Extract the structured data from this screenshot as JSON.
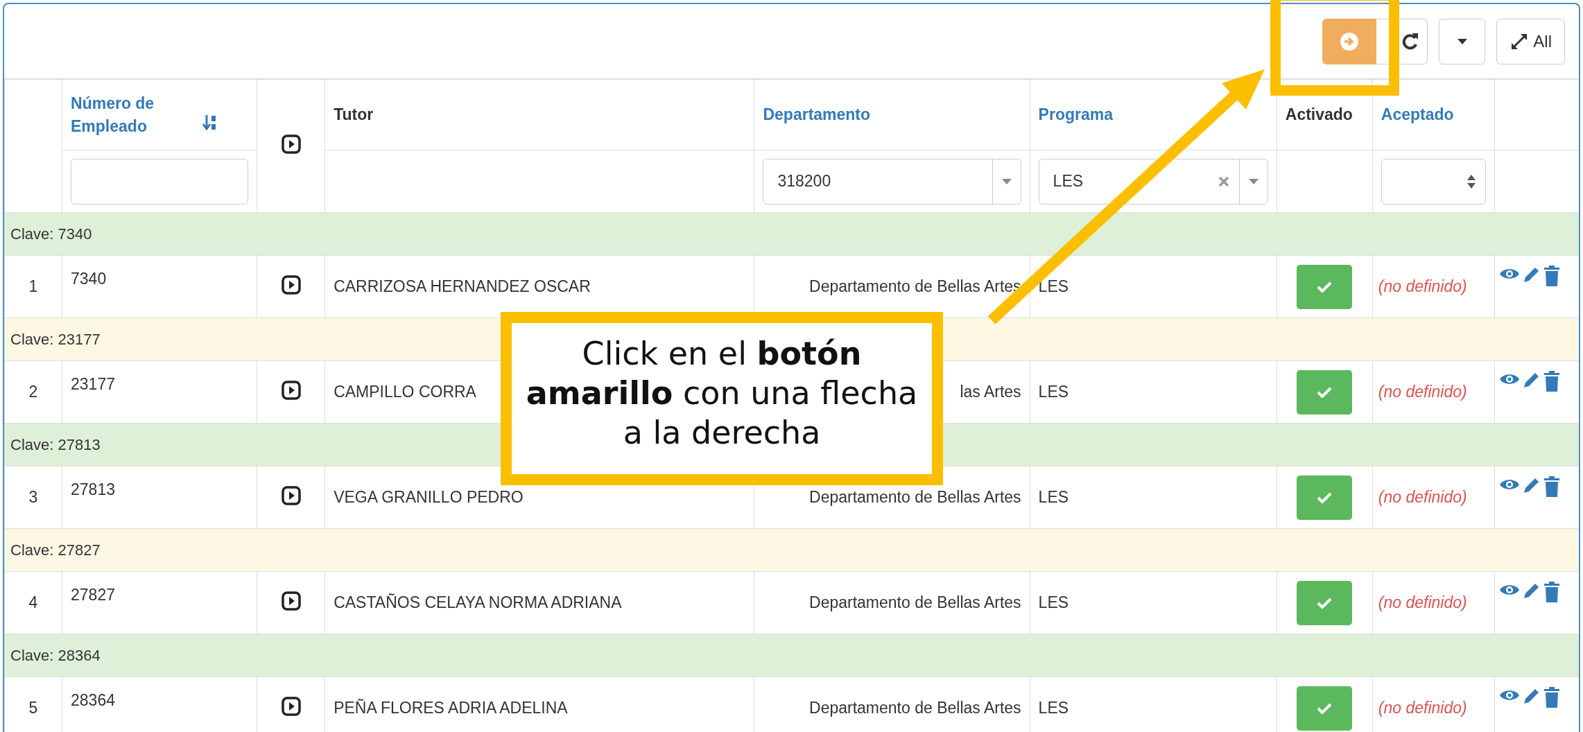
{
  "toolbar": {
    "buttons": [
      {
        "kind": "arrow"
      },
      {
        "kind": "refresh"
      },
      {
        "kind": "caret"
      },
      {
        "kind": "expand",
        "label": "All"
      }
    ]
  },
  "columns": [
    {
      "kind": "text",
      "label": "Número de Empleado",
      "sortable": true,
      "sorted": true,
      "filter": {
        "kind": "text"
      }
    },
    {
      "kind": "play"
    },
    {
      "kind": "text",
      "label": "Tutor",
      "sortable": false,
      "sorted": false
    },
    {
      "kind": "text",
      "label": "Departamento",
      "sortable": true,
      "sorted": false,
      "filter": {
        "kind": "select",
        "value": "318200",
        "clearable": false
      }
    },
    {
      "kind": "text",
      "label": "Programa",
      "sortable": true,
      "sorted": false,
      "filter": {
        "kind": "select",
        "value": "LES",
        "clearable": true
      }
    },
    {
      "kind": "text",
      "label": "Activado",
      "sortable": false,
      "sorted": false
    },
    {
      "kind": "text",
      "label": "Aceptado",
      "sortable": true,
      "sorted": false,
      "filter": {
        "kind": "spinner"
      }
    }
  ],
  "groups": [
    {
      "label": "Clave: 7340",
      "color": "#dff0d8",
      "row": {
        "index": "1",
        "number": "7340",
        "tutor": "CARRIZOSA HERNANDEZ OSCAR",
        "department": "Departamento de Bellas Artes",
        "program": "LES",
        "activated": true,
        "accepted": "(no definido)"
      }
    },
    {
      "label": "Clave: 23177",
      "color": "#fcf8e3",
      "row": {
        "index": "2",
        "number": "23177",
        "tutor": "CAMPILLO CORRA",
        "department": "las Artes",
        "program": "LES",
        "activated": true,
        "accepted": "(no definido)"
      }
    },
    {
      "label": "Clave: 27813",
      "color": "#dff0d8",
      "row": {
        "index": "3",
        "number": "27813",
        "tutor": "VEGA GRANILLO PEDRO",
        "department": "Departamento de Bellas Artes",
        "program": "LES",
        "activated": true,
        "accepted": "(no definido)"
      }
    },
    {
      "label": "Clave: 27827",
      "color": "#fcf8e3",
      "row": {
        "index": "4",
        "number": "27827",
        "tutor": "CASTAÑOS CELAYA NORMA ADRIANA",
        "department": "Departamento de Bellas Artes",
        "program": "LES",
        "activated": true,
        "accepted": "(no definido)"
      }
    },
    {
      "label": "Clave: 28364",
      "color": "#dff0d8",
      "row": {
        "index": "5",
        "number": "28364",
        "tutor": "PEÑA FLORES ADRIA ADELINA",
        "department": "Departamento de Bellas Artes",
        "program": "LES",
        "activated": true,
        "accepted": "(no definido)"
      }
    }
  ],
  "callout": {
    "text": "Click en el **botón amarillo** con una flecha a la derecha"
  }
}
